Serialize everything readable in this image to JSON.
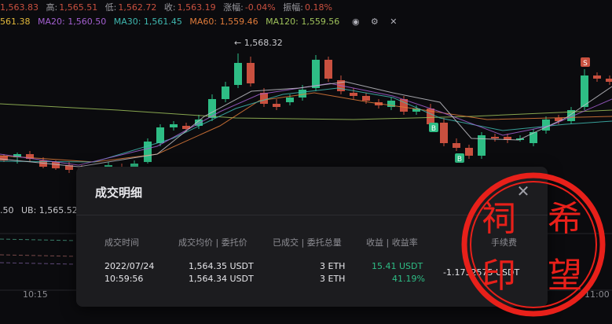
{
  "ohlc": {
    "open_value": "1,563.83",
    "high_label": "高:",
    "high_value": "1,565.51",
    "low_label": "低:",
    "low_value": "1,562.72",
    "close_label": "收:",
    "close_value": "1,563.19",
    "change_label": "涨幅:",
    "change_value": "-0.04%",
    "amp_label": "振幅:",
    "amp_value": "0.18%"
  },
  "ma": {
    "ma_first": "561.38",
    "ma20": "MA20: 1,560.50",
    "ma30": "MA30: 1,561.45",
    "ma60": "MA60: 1,559.46",
    "ma120": "MA120: 1,559.56",
    "colors": {
      "first": "#e2b93b",
      "ma20": "#a35fd0",
      "ma30": "#3fb8b0",
      "ma60": "#e07b3a",
      "ma120": "#9ec15a"
    }
  },
  "chart": {
    "high_marker": "1,568.32",
    "sub_left": ".50",
    "ub_label": "UB: 1,565.52",
    "time_left": "10:15",
    "time_right": "11:00",
    "buy_badge": "B",
    "sell_badge": "S",
    "up_color": "#2ebd85",
    "down_color": "#c9503f"
  },
  "modal": {
    "title": "成交明细",
    "headers": [
      "成交时间",
      "成交均价 | 委托价",
      "已成交 | 委托总量",
      "收益 | 收益率",
      "手续费"
    ],
    "date": "2022/07/24",
    "time": "10:59:56",
    "avg_price": "1,564.35 USDT",
    "order_price": "1,564.34 USDT",
    "filled": "3 ETH",
    "total": "3 ETH",
    "pnl": "15.41 USDT",
    "pnl_rate": "41.19%",
    "fee": "-1.1732575 USDT"
  },
  "stamp": {
    "text": "祠希印望",
    "color": "#e8201a"
  }
}
